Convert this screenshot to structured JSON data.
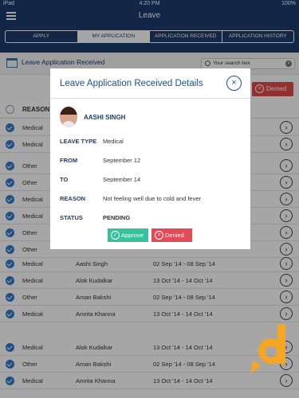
{
  "status_bar": {
    "carrier": "iPad",
    "time": "4:20 PM",
    "battery": "100%"
  },
  "nav": {
    "title": "Leave"
  },
  "tabs": [
    {
      "label": "APPLY"
    },
    {
      "label": "MY APPLICATION"
    },
    {
      "label": "APPLICATION RECEIVED"
    },
    {
      "label": "APPLICATION HISTORY"
    }
  ],
  "header": {
    "title": "Leave Application Received"
  },
  "search": {
    "value": "Your search box"
  },
  "bulk": {
    "denied_label": "Denied"
  },
  "list": {
    "reason_header": "REASON"
  },
  "rows": [
    {
      "type": "Medical",
      "name": "",
      "dates": ""
    },
    {
      "type": "Medical",
      "name": "",
      "dates": ""
    },
    {
      "type": "Other",
      "name": "",
      "dates": ""
    },
    {
      "type": "Other",
      "name": "",
      "dates": ""
    },
    {
      "type": "Medical",
      "name": "",
      "dates": ""
    },
    {
      "type": "Medical",
      "name": "",
      "dates": ""
    },
    {
      "type": "Other",
      "name": "",
      "dates": ""
    },
    {
      "type": "Other",
      "name": "",
      "dates": ""
    },
    {
      "type": "Medical",
      "name": "Aashi Singh",
      "dates": "02 Sep '14 - 08 Sep '14"
    },
    {
      "type": "Medical",
      "name": "Alok Kudalkar",
      "dates": "13 Oct '14 - 14 Oct '14"
    },
    {
      "type": "Other",
      "name": "Aman Bakshi",
      "dates": "02 Sep '14 - 08 Sep '14"
    },
    {
      "type": "Medical",
      "name": "Amrita Khanna",
      "dates": "13 Oct '14 - 14 Oct '14"
    },
    {
      "type": "Medical",
      "name": "Alok Kudalkar",
      "dates": "13 Oct '14 - 14 Oct '14"
    },
    {
      "type": "Other",
      "name": "Aman Bakshi",
      "dates": "02 Sep '14 - 08 Sep '14"
    },
    {
      "type": "Medical",
      "name": "Amrita Khanna",
      "dates": "13 Oct '14 - 14 Oct '14"
    }
  ],
  "modal": {
    "title": "Leave Application Received Details",
    "employee_name": "AASHI SINGH",
    "fields": {
      "leave_type_label": "LEAVE TYPE",
      "leave_type": "Medical",
      "from_label": "FROM",
      "from": "September 12",
      "to_label": "TO",
      "to": "September 14",
      "reason_label": "REASON",
      "reason": "Not feeling well due to cold and fever",
      "status_label": "STATUS",
      "status": "PENDING"
    },
    "approve_label": "Approve",
    "denied_label": "Denied"
  }
}
